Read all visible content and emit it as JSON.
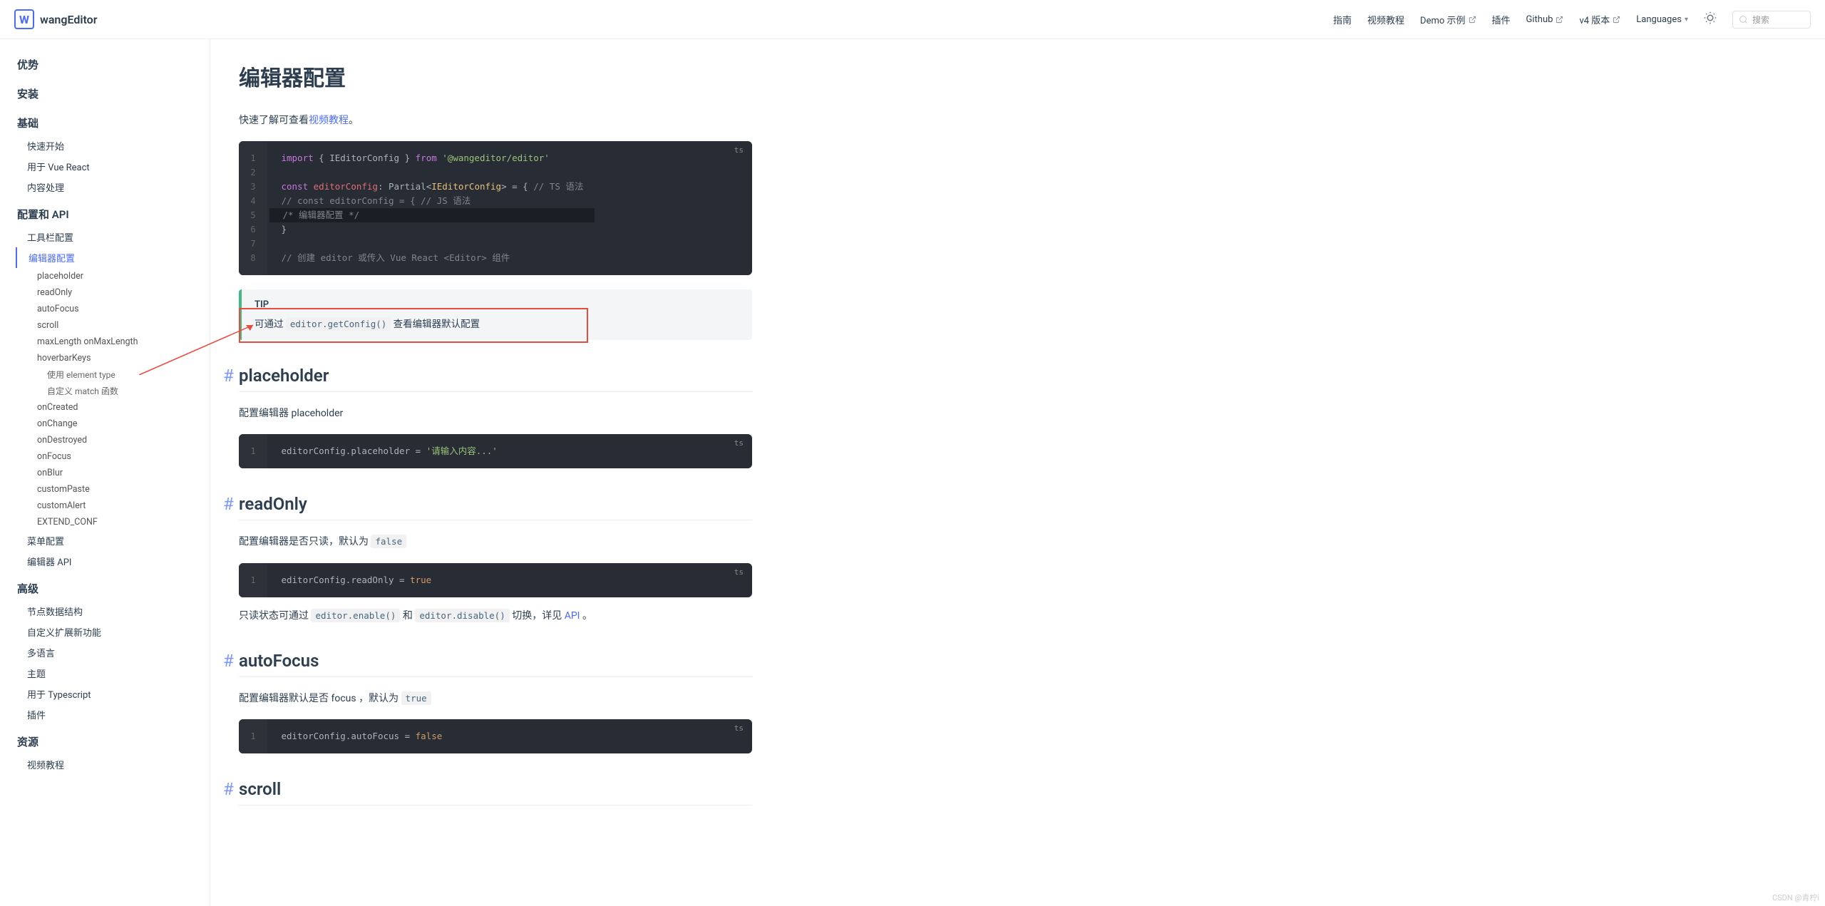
{
  "header": {
    "brand": "wangEditor",
    "nav": {
      "guide": "指南",
      "video": "视频教程",
      "demo": "Demo 示例",
      "plugin": "插件",
      "github": "Github",
      "v4": "v4 版本",
      "languages": "Languages"
    },
    "search_placeholder": "搜索"
  },
  "sidebar": {
    "g1": "优势",
    "g2": "安装",
    "g3": "基础",
    "g3_items": {
      "quickstart": "快速开始",
      "vuereact": "用于 Vue React",
      "content": "内容处理"
    },
    "g4": "配置和 API",
    "g4_items": {
      "toolbar": "工具栏配置",
      "editor": "编辑器配置",
      "subs": {
        "placeholder": "placeholder",
        "readOnly": "readOnly",
        "autoFocus": "autoFocus",
        "scroll": "scroll",
        "maxLength": "maxLength onMaxLength",
        "hoverbarKeys": "hoverbarKeys",
        "elementType": "使用 element type",
        "matchFn": "自定义 match 函数",
        "onCreated": "onCreated",
        "onChange": "onChange",
        "onDestroyed": "onDestroyed",
        "onFocus": "onFocus",
        "onBlur": "onBlur",
        "customPaste": "customPaste",
        "customAlert": "customAlert",
        "extendConf": "EXTEND_CONF"
      },
      "menu": "菜单配置",
      "editorApi": "编辑器 API"
    },
    "g5": "高级",
    "g5_items": {
      "nodeData": "节点数据结构",
      "extend": "自定义扩展新功能",
      "i18n": "多语言",
      "theme": "主题",
      "typescript": "用于 Typescript",
      "plugins": "插件"
    },
    "g6": "资源",
    "g6_items": {
      "video": "视频教程"
    }
  },
  "article": {
    "title": "编辑器配置",
    "intro_pre": "快速了解可查看",
    "intro_link": "视频教程",
    "intro_post": "。",
    "code1": {
      "lang": "ts",
      "l1_a": "import",
      "l1_b": " { IEditorConfig } ",
      "l1_c": "from",
      "l1_d": " '@wangeditor/editor'",
      "l3_a": "const",
      "l3_b": " editorConfig",
      "l3_c": ": Partial<",
      "l3_d": "IEditorConfig",
      "l3_e": "> = {   ",
      "l3_f": "// TS 语法",
      "l4": "// const editorConfig = {                        // JS 语法",
      "l5": "    /* 编辑器配置 */",
      "l6": "}",
      "l8": "// 创建 editor 或传入 Vue React <Editor> 组件"
    },
    "tip": {
      "label": "TIP",
      "pre": "可通过 ",
      "code": "editor.getConfig()",
      "post": " 查看编辑器默认配置"
    },
    "s_placeholder": {
      "title": "placeholder",
      "desc": "配置编辑器 placeholder"
    },
    "code_placeholder": {
      "lang": "ts",
      "line": "editorConfig.placeholder = ",
      "value": "'请输入内容...'"
    },
    "s_readOnly": {
      "title": "readOnly",
      "desc_pre": "配置编辑器是否只读，默认为 ",
      "desc_code": "false"
    },
    "code_readOnly": {
      "lang": "ts",
      "line": "editorConfig.readOnly = ",
      "value": "true"
    },
    "readOnly_note": {
      "pre": "只读状态可通过 ",
      "c1": "editor.enable()",
      "mid": " 和 ",
      "c2": "editor.disable()",
      "post1": " 切换，详见 ",
      "link": "API",
      "post2": " 。"
    },
    "s_autoFocus": {
      "title": "autoFocus",
      "desc_pre": "配置编辑器默认是否 focus ，默认为 ",
      "desc_code": "true"
    },
    "code_autoFocus": {
      "lang": "ts",
      "line": "editorConfig.autoFocus = ",
      "value": "false"
    },
    "s_scroll": {
      "title": "scroll"
    }
  },
  "watermark": "CSDN @青柠i"
}
